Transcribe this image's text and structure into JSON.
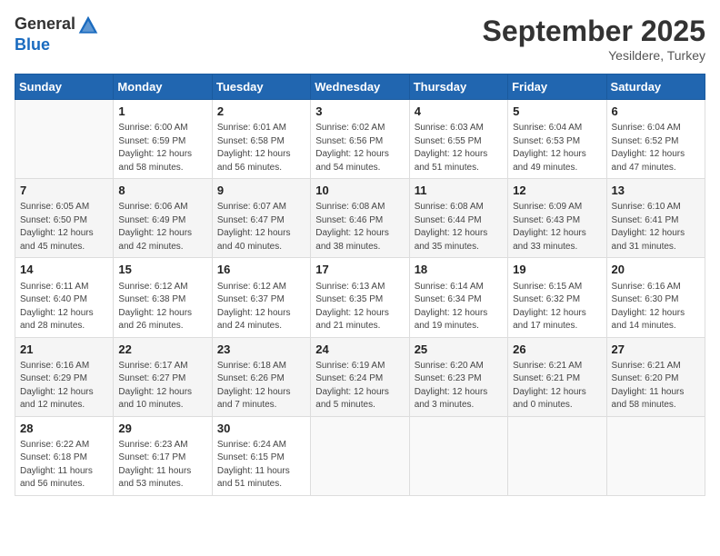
{
  "header": {
    "logo_general": "General",
    "logo_blue": "Blue",
    "month": "September 2025",
    "location": "Yesildere, Turkey"
  },
  "weekdays": [
    "Sunday",
    "Monday",
    "Tuesday",
    "Wednesday",
    "Thursday",
    "Friday",
    "Saturday"
  ],
  "weeks": [
    [
      {
        "day": "",
        "info": ""
      },
      {
        "day": "1",
        "info": "Sunrise: 6:00 AM\nSunset: 6:59 PM\nDaylight: 12 hours\nand 58 minutes."
      },
      {
        "day": "2",
        "info": "Sunrise: 6:01 AM\nSunset: 6:58 PM\nDaylight: 12 hours\nand 56 minutes."
      },
      {
        "day": "3",
        "info": "Sunrise: 6:02 AM\nSunset: 6:56 PM\nDaylight: 12 hours\nand 54 minutes."
      },
      {
        "day": "4",
        "info": "Sunrise: 6:03 AM\nSunset: 6:55 PM\nDaylight: 12 hours\nand 51 minutes."
      },
      {
        "day": "5",
        "info": "Sunrise: 6:04 AM\nSunset: 6:53 PM\nDaylight: 12 hours\nand 49 minutes."
      },
      {
        "day": "6",
        "info": "Sunrise: 6:04 AM\nSunset: 6:52 PM\nDaylight: 12 hours\nand 47 minutes."
      }
    ],
    [
      {
        "day": "7",
        "info": "Sunrise: 6:05 AM\nSunset: 6:50 PM\nDaylight: 12 hours\nand 45 minutes."
      },
      {
        "day": "8",
        "info": "Sunrise: 6:06 AM\nSunset: 6:49 PM\nDaylight: 12 hours\nand 42 minutes."
      },
      {
        "day": "9",
        "info": "Sunrise: 6:07 AM\nSunset: 6:47 PM\nDaylight: 12 hours\nand 40 minutes."
      },
      {
        "day": "10",
        "info": "Sunrise: 6:08 AM\nSunset: 6:46 PM\nDaylight: 12 hours\nand 38 minutes."
      },
      {
        "day": "11",
        "info": "Sunrise: 6:08 AM\nSunset: 6:44 PM\nDaylight: 12 hours\nand 35 minutes."
      },
      {
        "day": "12",
        "info": "Sunrise: 6:09 AM\nSunset: 6:43 PM\nDaylight: 12 hours\nand 33 minutes."
      },
      {
        "day": "13",
        "info": "Sunrise: 6:10 AM\nSunset: 6:41 PM\nDaylight: 12 hours\nand 31 minutes."
      }
    ],
    [
      {
        "day": "14",
        "info": "Sunrise: 6:11 AM\nSunset: 6:40 PM\nDaylight: 12 hours\nand 28 minutes."
      },
      {
        "day": "15",
        "info": "Sunrise: 6:12 AM\nSunset: 6:38 PM\nDaylight: 12 hours\nand 26 minutes."
      },
      {
        "day": "16",
        "info": "Sunrise: 6:12 AM\nSunset: 6:37 PM\nDaylight: 12 hours\nand 24 minutes."
      },
      {
        "day": "17",
        "info": "Sunrise: 6:13 AM\nSunset: 6:35 PM\nDaylight: 12 hours\nand 21 minutes."
      },
      {
        "day": "18",
        "info": "Sunrise: 6:14 AM\nSunset: 6:34 PM\nDaylight: 12 hours\nand 19 minutes."
      },
      {
        "day": "19",
        "info": "Sunrise: 6:15 AM\nSunset: 6:32 PM\nDaylight: 12 hours\nand 17 minutes."
      },
      {
        "day": "20",
        "info": "Sunrise: 6:16 AM\nSunset: 6:30 PM\nDaylight: 12 hours\nand 14 minutes."
      }
    ],
    [
      {
        "day": "21",
        "info": "Sunrise: 6:16 AM\nSunset: 6:29 PM\nDaylight: 12 hours\nand 12 minutes."
      },
      {
        "day": "22",
        "info": "Sunrise: 6:17 AM\nSunset: 6:27 PM\nDaylight: 12 hours\nand 10 minutes."
      },
      {
        "day": "23",
        "info": "Sunrise: 6:18 AM\nSunset: 6:26 PM\nDaylight: 12 hours\nand 7 minutes."
      },
      {
        "day": "24",
        "info": "Sunrise: 6:19 AM\nSunset: 6:24 PM\nDaylight: 12 hours\nand 5 minutes."
      },
      {
        "day": "25",
        "info": "Sunrise: 6:20 AM\nSunset: 6:23 PM\nDaylight: 12 hours\nand 3 minutes."
      },
      {
        "day": "26",
        "info": "Sunrise: 6:21 AM\nSunset: 6:21 PM\nDaylight: 12 hours\nand 0 minutes."
      },
      {
        "day": "27",
        "info": "Sunrise: 6:21 AM\nSunset: 6:20 PM\nDaylight: 11 hours\nand 58 minutes."
      }
    ],
    [
      {
        "day": "28",
        "info": "Sunrise: 6:22 AM\nSunset: 6:18 PM\nDaylight: 11 hours\nand 56 minutes."
      },
      {
        "day": "29",
        "info": "Sunrise: 6:23 AM\nSunset: 6:17 PM\nDaylight: 11 hours\nand 53 minutes."
      },
      {
        "day": "30",
        "info": "Sunrise: 6:24 AM\nSunset: 6:15 PM\nDaylight: 11 hours\nand 51 minutes."
      },
      {
        "day": "",
        "info": ""
      },
      {
        "day": "",
        "info": ""
      },
      {
        "day": "",
        "info": ""
      },
      {
        "day": "",
        "info": ""
      }
    ]
  ]
}
